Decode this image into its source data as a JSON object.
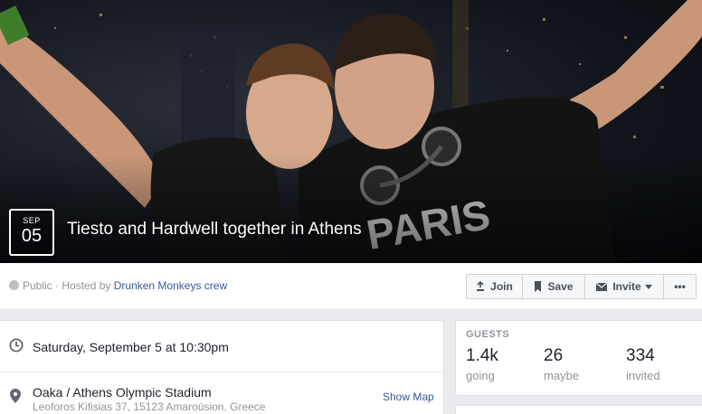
{
  "event": {
    "month": "SEP",
    "day": "05",
    "title": "Tiesto and Hardwell together in Athens"
  },
  "info_bar": {
    "privacy": "Public",
    "separator": " · ",
    "hosted_by": "Hosted by ",
    "host": "Drunken Monkeys crew"
  },
  "actions": {
    "join": "Join",
    "save": "Save",
    "invite": "Invite",
    "more": "•••"
  },
  "details": {
    "when": "Saturday, September 5 at 10:30pm",
    "place": "Oaka / Athens Olympic Stadium",
    "address": "Leoforos Kifisias 37, 15123 Amaroúsion, Greece",
    "show_map": "Show Map"
  },
  "guests": {
    "title": "GUESTS",
    "going_count": "1.4k",
    "going_label": "going",
    "maybe_count": "26",
    "maybe_label": "maybe",
    "invited_count": "334",
    "invited_label": "invited"
  },
  "colors": {
    "link": "#365899",
    "muted": "#90949c",
    "page_bg": "#e9ebee"
  },
  "icons": [
    "globe-icon",
    "join-icon",
    "bookmark-icon",
    "mail-icon",
    "caret-down-icon",
    "clock-icon",
    "map-pin-icon"
  ]
}
